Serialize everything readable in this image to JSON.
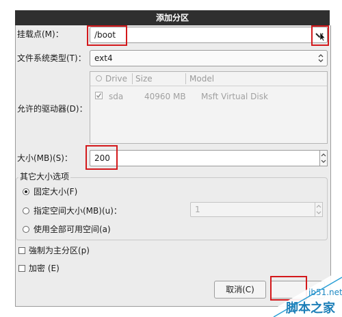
{
  "window": {
    "title": "添加分区"
  },
  "mount_point": {
    "label": "挂载点(M)：",
    "value": "/boot",
    "dropdown_icon": "chevron-down-icon"
  },
  "fs_type": {
    "label": "文件系统类型(T)：",
    "value": "ext4"
  },
  "drives": {
    "label": "允许的驱动器(D)：",
    "columns": [
      "Drive",
      "Size",
      "Model"
    ],
    "rows": [
      {
        "checked": true,
        "drive": "sda",
        "size": "40960 MB",
        "model": "Msft Virtual Disk"
      }
    ]
  },
  "size": {
    "label": "大小(MB)(S)：",
    "value": "200"
  },
  "other_size": {
    "legend": "其它大小选项",
    "options": [
      {
        "label": "固定大小(F)",
        "selected": true
      },
      {
        "label": "指定空间大小(MB)(u)：",
        "selected": false,
        "value": "1"
      },
      {
        "label": "使用全部可用空间(a)",
        "selected": false
      }
    ]
  },
  "force_primary": {
    "label": "強制为主分区(p)",
    "checked": false
  },
  "encrypt": {
    "label": "加密 (E)",
    "checked": false
  },
  "buttons": {
    "cancel": "取消(C)"
  },
  "watermark": {
    "site": "jb51.net",
    "brand": "脚本之家"
  },
  "colors": {
    "highlight": "#d3181b",
    "titlebar": "#2f2f2f",
    "dialog_bg": "#ececec"
  }
}
